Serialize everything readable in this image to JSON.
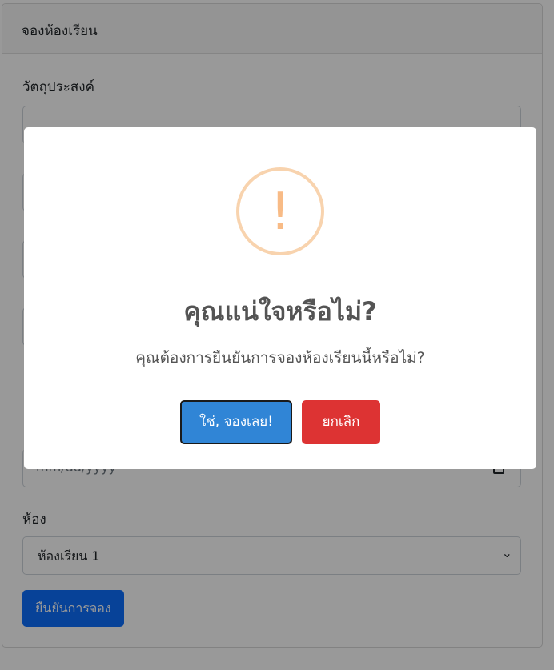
{
  "card": {
    "header_title": "จองห้องเรียน"
  },
  "form": {
    "purpose_label": "วัตถุประสงค์",
    "date_placeholder": "mm/dd/yyyy",
    "room_label": "ห้อง",
    "room_value": "ห้องเรียน 1",
    "submit_label": "ยืนยันการจอง"
  },
  "modal": {
    "icon": "!",
    "title": "คุณแน่ใจหรือไม่?",
    "text": "คุณต้องการยืนยันการจองห้องเรียนนี้หรือไม่?",
    "confirm_label": "ใช่, จองเลย!",
    "cancel_label": "ยกเลิก"
  },
  "colors": {
    "confirm": "#3085d6",
    "cancel": "#dd3333",
    "warning": "#f8bb86",
    "primary": "#0d6efd"
  }
}
